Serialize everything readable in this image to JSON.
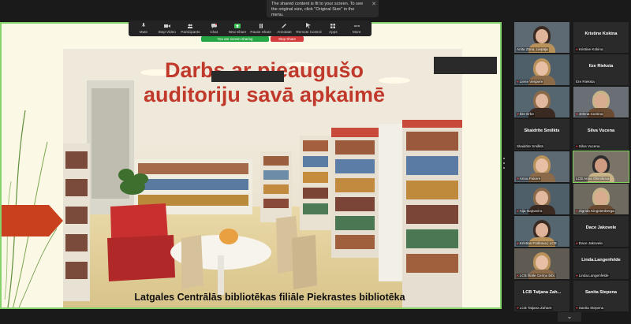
{
  "notice": {
    "text": "The shared content is fit to your screen. To see the original size, click \"Original Size\" in the menu.",
    "close": "✕"
  },
  "toolbar": {
    "items": [
      {
        "label": "Mute",
        "icon": "microphone-icon"
      },
      {
        "label": "Stop Video",
        "icon": "video-camera-icon"
      },
      {
        "label": "Participants",
        "icon": "participants-icon"
      },
      {
        "label": "Chat",
        "icon": "chat-icon"
      },
      {
        "label": "New Share",
        "icon": "share-screen-icon"
      },
      {
        "label": "Pause Share",
        "icon": "pause-icon"
      },
      {
        "label": "Annotate",
        "icon": "annotate-icon"
      },
      {
        "label": "Remote Control",
        "icon": "remote-control-icon"
      },
      {
        "label": "Apps",
        "icon": "apps-icon"
      },
      {
        "label": "More",
        "icon": "more-icon"
      }
    ],
    "sharing_label": "You are screen sharing",
    "stop_label": "Stop Share"
  },
  "slide": {
    "title_line1": "Darbs ar pieaugušo",
    "title_line2": "auditoriju savā apkaimē",
    "caption": "Latgales Centrālās bibliotēkas  filiāle Piekrastes bibliotēka"
  },
  "participants": [
    {
      "name_top": "",
      "label": "Anita Zūna, Liepāja",
      "video": true,
      "col": 0,
      "row": 0,
      "mic_muted": false
    },
    {
      "name_top": "Kristine Kokina",
      "label": "Kristine Kokina",
      "video": false,
      "col": 1,
      "row": 0,
      "mic_muted": true
    },
    {
      "name_top": "",
      "label": "Liene Vespere",
      "video": true,
      "col": 0,
      "row": 1,
      "mic_muted": true
    },
    {
      "name_top": "Ilze Rieksta",
      "label": "Ilze Rieksta",
      "video": false,
      "col": 1,
      "row": 1,
      "mic_muted": false
    },
    {
      "name_top": "",
      "label": "Ilze Erbe",
      "video": true,
      "col": 0,
      "row": 2,
      "mic_muted": true
    },
    {
      "name_top": "",
      "label": "Jelena Cursina",
      "video": true,
      "col": 1,
      "row": 2,
      "mic_muted": true
    },
    {
      "name_top": "Skaidrite Smilkts",
      "label": "Skaidrite Smilkts",
      "video": false,
      "col": 0,
      "row": 3,
      "mic_muted": false
    },
    {
      "name_top": "Silva Vucena",
      "label": "Silva Vucena",
      "video": false,
      "col": 1,
      "row": 3,
      "mic_muted": true
    },
    {
      "name_top": "",
      "label": "Anna Pakere",
      "video": true,
      "col": 0,
      "row": 4,
      "mic_muted": true
    },
    {
      "name_top": "",
      "label": "LCB Anna Olenikova",
      "video": true,
      "col": 1,
      "row": 4,
      "mic_muted": false,
      "active": true
    },
    {
      "name_top": "",
      "label": "Aija Isajnavira",
      "video": true,
      "col": 0,
      "row": 5,
      "mic_muted": true
    },
    {
      "name_top": "",
      "label": "Zigrida Kingstenberga",
      "video": true,
      "col": 1,
      "row": 5,
      "mic_muted": true
    },
    {
      "name_top": "",
      "label": "Kristine Frolkova | LCB",
      "video": true,
      "col": 0,
      "row": 6,
      "mic_muted": true
    },
    {
      "name_top": "Dace Jakovele",
      "label": "Dace Jakovele",
      "video": false,
      "col": 1,
      "row": 6,
      "mic_muted": true
    },
    {
      "name_top": "",
      "label": "LCB filiāle Ceriņu bibl.",
      "video": true,
      "col": 0,
      "row": 7,
      "mic_muted": true
    },
    {
      "name_top": "Linda.Langenfelde",
      "label": "Linda.Langenfelde",
      "video": false,
      "col": 1,
      "row": 7,
      "mic_muted": true
    },
    {
      "name_top": "LCB Tatjana Zah...",
      "label": "LCB Tatjana Zahare",
      "video": false,
      "col": 0,
      "row": 8,
      "mic_muted": true
    },
    {
      "name_top": "Sanita Stepena",
      "label": "Sanita Stepena",
      "video": false,
      "col": 1,
      "row": 8,
      "mic_muted": true
    }
  ],
  "colors": {
    "slide_bg": "#fbf8e6",
    "slide_border": "#87d36b",
    "title": "#c0392b",
    "arrow": "#c8401e",
    "share_green": "#26a544",
    "stop_red": "#d23b3b"
  },
  "gallery_chevron": "⌄"
}
